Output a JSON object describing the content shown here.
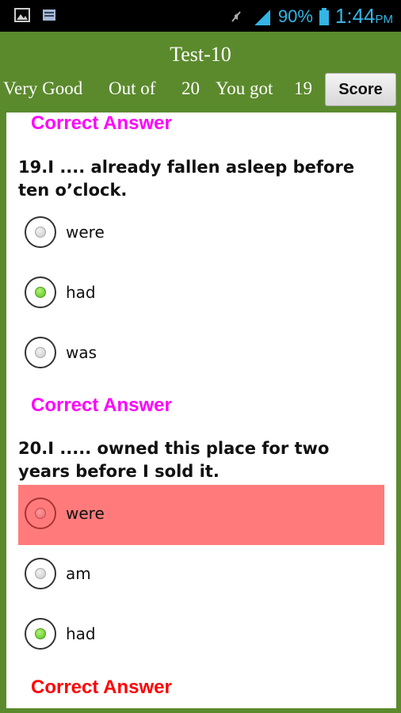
{
  "status_bar": {
    "icons": [
      "image-icon",
      "store-icon",
      "mute-icon",
      "signal-icon",
      "battery-icon"
    ],
    "battery": "90%",
    "time": "1:44",
    "ampm": "PM"
  },
  "header": {
    "title": "Test-10",
    "rating": "Very Good",
    "out_of_label": "Out of",
    "total": "20",
    "you_got_label": "You got",
    "score": "19",
    "score_button": "Score"
  },
  "colors": {
    "header_bg": "#5b8a2d",
    "correct_magenta": "#ff00ff",
    "correct_red": "#ff0000",
    "wrong_option_bg": "#ff7b7b",
    "selected_green": "#52c41a"
  },
  "top_banner": {
    "text": "Correct Answer"
  },
  "questions": [
    {
      "text": "19.I .... already fallen asleep before ten o’clock.",
      "options": [
        {
          "label": "were",
          "selected": false,
          "wrong": false
        },
        {
          "label": "had",
          "selected": true,
          "wrong": false
        },
        {
          "label": "was",
          "selected": false,
          "wrong": false
        }
      ],
      "result": "Correct Answer"
    },
    {
      "text": "20.I ..... owned this place for two years before I sold it.",
      "options": [
        {
          "label": "were",
          "selected": false,
          "wrong": true
        },
        {
          "label": "am",
          "selected": false,
          "wrong": false
        },
        {
          "label": "had",
          "selected": true,
          "wrong": false
        }
      ],
      "result": "Correct Answer"
    }
  ]
}
